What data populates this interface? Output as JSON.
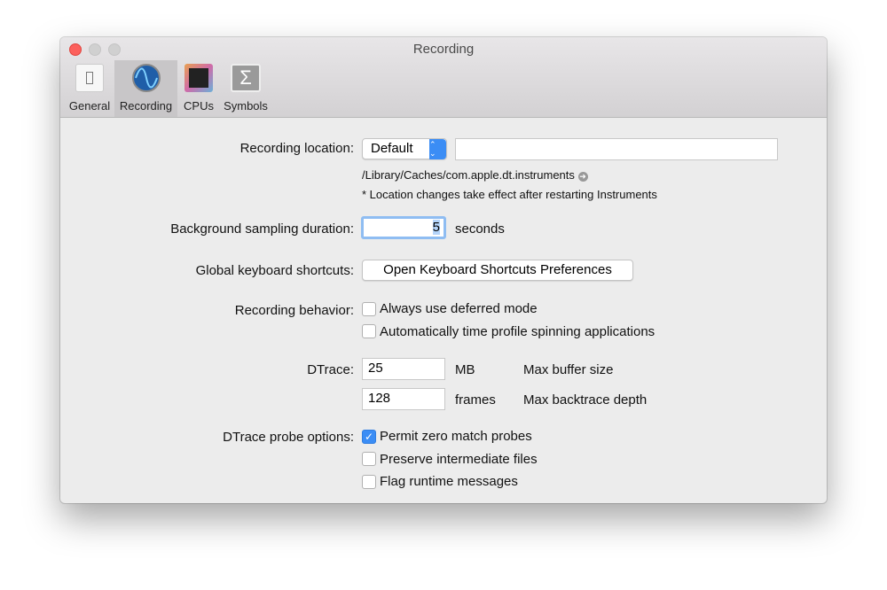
{
  "window": {
    "title": "Recording"
  },
  "tabs": [
    {
      "label": "General"
    },
    {
      "label": "Recording"
    },
    {
      "label": "CPUs"
    },
    {
      "label": "Symbols"
    }
  ],
  "recording_location": {
    "label": "Recording location:",
    "select_value": "Default",
    "path_value": "",
    "path": "/Library/Caches/com.apple.dt.instruments",
    "note": "* Location changes take effect after restarting Instruments"
  },
  "background": {
    "label": "Background sampling duration:",
    "value": "5",
    "unit": "seconds"
  },
  "shortcuts": {
    "label": "Global keyboard shortcuts:",
    "button": "Open Keyboard Shortcuts Preferences"
  },
  "behavior": {
    "label": "Recording behavior:",
    "options": [
      {
        "label": "Always use deferred mode",
        "checked": false
      },
      {
        "label": "Automatically time profile spinning applications",
        "checked": false
      }
    ]
  },
  "dtrace": {
    "label": "DTrace:",
    "buffer_value": "25",
    "buffer_unit": "MB",
    "buffer_desc": "Max buffer size",
    "depth_value": "128",
    "depth_unit": "frames",
    "depth_desc": "Max backtrace depth"
  },
  "probe": {
    "label": "DTrace probe options:",
    "options": [
      {
        "label": "Permit zero match probes",
        "checked": true
      },
      {
        "label": "Preserve intermediate files",
        "checked": false
      },
      {
        "label": "Flag runtime messages",
        "checked": false
      }
    ]
  }
}
